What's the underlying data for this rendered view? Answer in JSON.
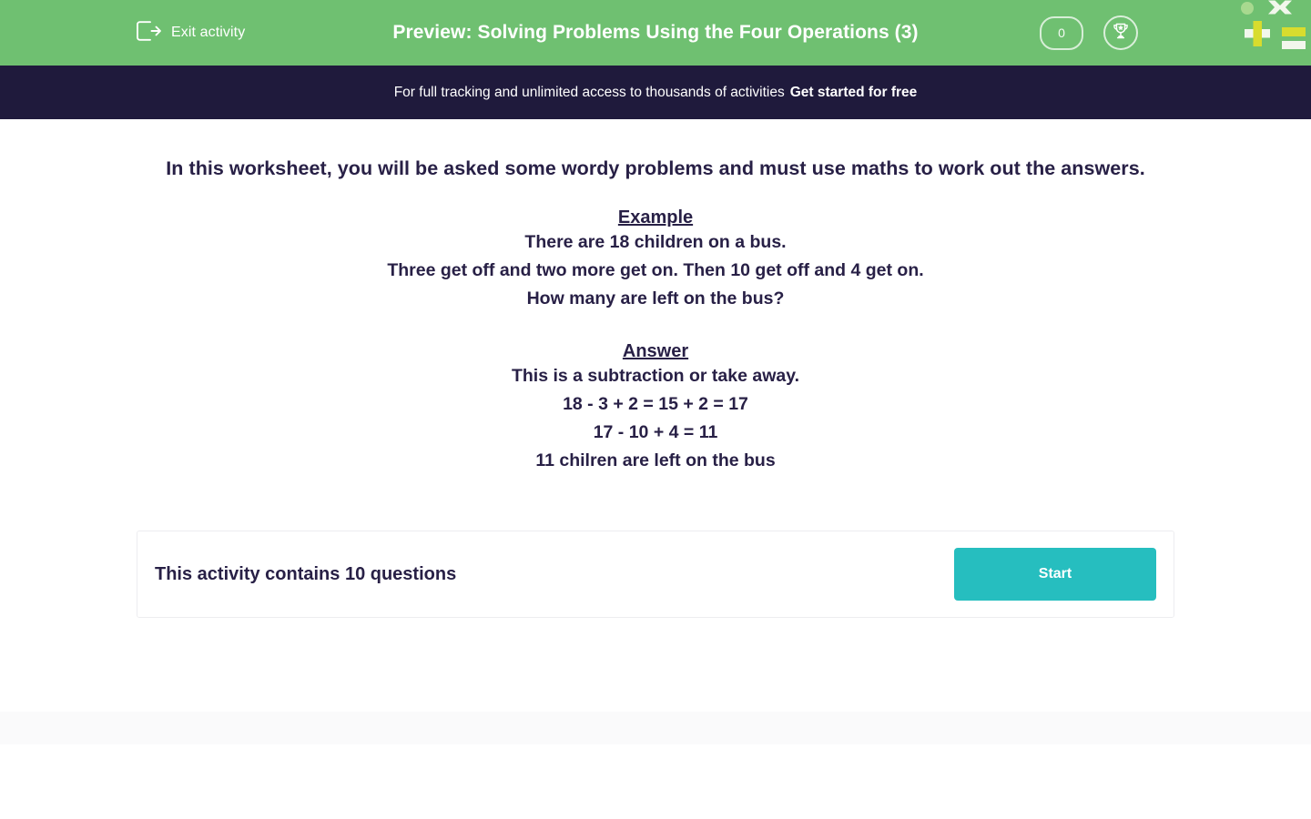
{
  "header": {
    "exit_label": "Exit activity",
    "exit_icon": "exit-arrow-icon",
    "title": "Preview: Solving Problems Using the Four Operations (3)",
    "score_value": "0",
    "trophy_icon": "trophy-icon",
    "brand_icon": "math-symbols-logo",
    "bg_color": "#6FC071"
  },
  "promo": {
    "text": "For full tracking and unlimited access to thousands of activities",
    "cta_label": "Get started for free",
    "bg_color": "#1F1A3C"
  },
  "main": {
    "intro": "In this worksheet, you will be asked some wordy problems and must use maths to work out the answers.",
    "example": {
      "title": "Example",
      "lines": [
        "There are 18 children on a bus.",
        "Three get off and two more get on. Then 10 get off and 4 get on.",
        "How many are left on the bus?"
      ]
    },
    "answer": {
      "title": "Answer",
      "lines": [
        "This is a subtraction or take away.",
        "18 - 3 + 2 = 15 + 2 = 17",
        "17 - 10 + 4 = 11"
      ],
      "conclusion_bold": "11",
      "conclusion_rest": " chilren are left on the bus"
    }
  },
  "start_card": {
    "count_text": "This activity contains 10 questions",
    "start_label": "Start",
    "button_color": "#26BEBF"
  }
}
